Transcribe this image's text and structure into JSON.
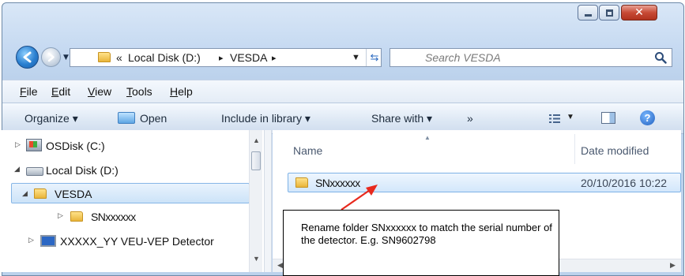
{
  "address_bar": {
    "overflow": "«",
    "crumbs": [
      "Local Disk (D:)",
      "VESDA"
    ],
    "separator": "▸"
  },
  "search": {
    "placeholder": "Search VESDA"
  },
  "menu": {
    "file": {
      "key": "F",
      "rest": "ile"
    },
    "edit": {
      "key": "E",
      "rest": "dit"
    },
    "view": {
      "key": "V",
      "rest": "iew"
    },
    "tools": {
      "key": "T",
      "rest": "ools"
    },
    "help": {
      "key": "H",
      "rest": "elp"
    }
  },
  "command_bar": {
    "organize": "Organize ▾",
    "open": "Open",
    "include_in_library": "Include in library ▾",
    "share_with": "Share with ▾",
    "more": "»"
  },
  "nav_tree": [
    {
      "label": "OSDisk (C:)",
      "expander": "▷"
    },
    {
      "label": "Local Disk (D:)",
      "expander": "◢"
    },
    {
      "label": "VESDA",
      "expander": "◢"
    },
    {
      "label": "SNxxxxxx",
      "expander": "▷"
    },
    {
      "label": "XXXXX_YY VEU-VEP Detector",
      "expander": "▷"
    }
  ],
  "file_list": {
    "columns": [
      "Name",
      "Date modified"
    ],
    "rows": [
      {
        "name": "SNxxxxxx",
        "date_modified": "20/10/2016 10:22"
      }
    ]
  },
  "callout": {
    "text": "Rename folder SNxxxxxx to match the serial number of the detector. E.g. SN9602798"
  },
  "colors": {
    "selection_fill": "#cce3f8",
    "selection_border": "#86b6e6",
    "close_button": "#c74a35",
    "arrow": "#e8291d"
  }
}
